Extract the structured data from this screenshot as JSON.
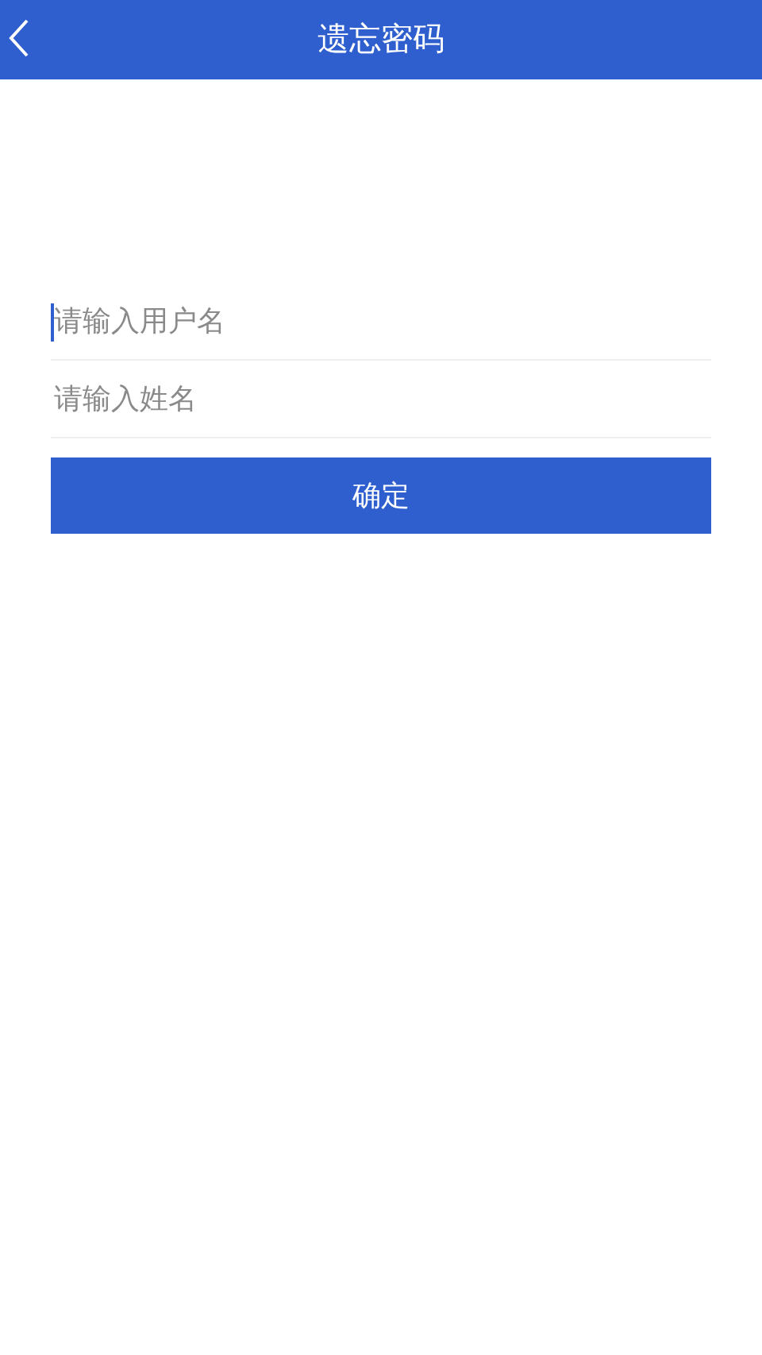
{
  "header": {
    "title": "遗忘密码"
  },
  "fields": [
    {
      "placeholder": "请输入用户名",
      "focused": true
    },
    {
      "placeholder": "请输入姓名",
      "focused": false
    }
  ],
  "submit": {
    "label": "确定"
  }
}
